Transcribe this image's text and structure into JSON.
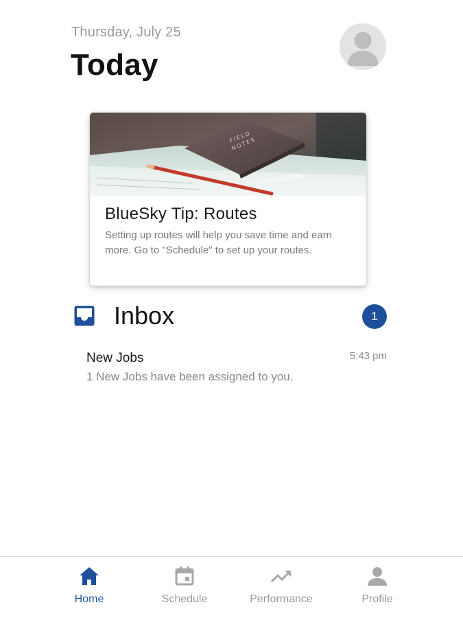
{
  "header": {
    "date": "Thursday, July 25",
    "title": "Today",
    "avatar_icon": "person-avatar-icon"
  },
  "tip_card": {
    "title": "BlueSky Tip: Routes",
    "body": "Setting up routes will help you save time and earn more. Go to \"Schedule\" to set up your routes.",
    "image_description_icon": "field-notes-notebook-photo"
  },
  "inbox": {
    "title": "Inbox",
    "icon": "inbox-tray-icon",
    "badge_count": "1",
    "messages": [
      {
        "title": "New Jobs",
        "time": "5:43 pm",
        "body": "1 New Jobs have been assigned to you."
      }
    ]
  },
  "tabbar": {
    "active": "Home",
    "tabs": [
      {
        "label": "Home",
        "icon": "home-icon"
      },
      {
        "label": "Schedule",
        "icon": "calendar-icon"
      },
      {
        "label": "Performance",
        "icon": "trending-up-icon"
      },
      {
        "label": "Profile",
        "icon": "person-icon"
      }
    ]
  },
  "colors": {
    "accent": "#1e5aa8",
    "badge": "#1e4f9a",
    "inactive": "#9a9a9a",
    "muted_text": "#8a8a8a"
  }
}
